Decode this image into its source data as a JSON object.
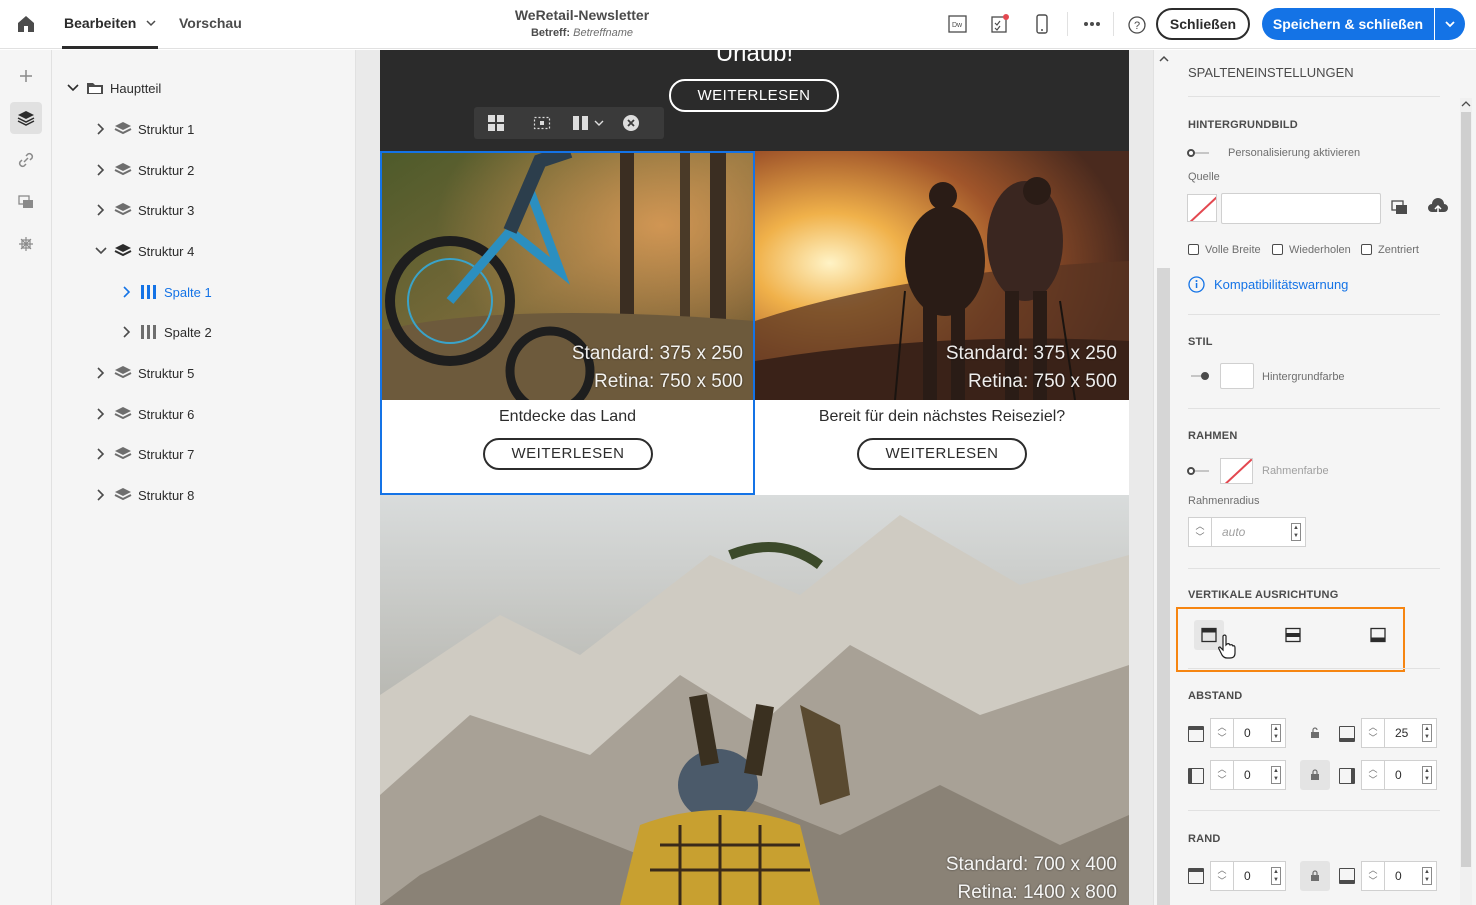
{
  "header": {
    "tabs": [
      {
        "label": "Bearbeiten"
      },
      {
        "label": "Vorschau"
      }
    ],
    "doc_title": "WeRetail-Newsletter",
    "subject_label": "Betreff:",
    "subject_value": "Betreffname",
    "close_label": "Schließen",
    "save_label": "Speichern & schließen",
    "icons": [
      "home-icon",
      "dreamweaver-icon",
      "checklist-icon",
      "mobile-icon",
      "more-icon",
      "help-icon"
    ]
  },
  "rail": {
    "items": [
      "add-icon",
      "layers-icon",
      "link-icon",
      "assets-icon",
      "fragments-icon"
    ],
    "active": "layers-icon"
  },
  "tree": {
    "root": "Hauptteil",
    "items": [
      {
        "label": "Struktur 1"
      },
      {
        "label": "Struktur 2"
      },
      {
        "label": "Struktur 3"
      },
      {
        "label": "Struktur 4"
      },
      {
        "label": "Spalte 1"
      },
      {
        "label": "Spalte 2"
      },
      {
        "label": "Struktur 5"
      },
      {
        "label": "Struktur 6"
      },
      {
        "label": "Struktur 7"
      },
      {
        "label": "Struktur 8"
      }
    ]
  },
  "email": {
    "hero_text": "Urlaub!",
    "hero_button": "WEITERLESEN",
    "col1": {
      "img_label_1": "Standard: 375 x 250",
      "img_label_2": "Retina: 750 x 500",
      "title": "Entdecke das Land",
      "button": "WEITERLESEN"
    },
    "col2": {
      "img_label_1": "Standard: 375 x 250",
      "img_label_2": "Retina: 750 x 500",
      "title": "Bereit für dein nächstes Reiseziel?",
      "button": "WEITERLESEN"
    },
    "big": {
      "img_label_1": "Standard: 700 x 400",
      "img_label_2": "Retina: 1400 x 800"
    }
  },
  "settings": {
    "title": "SPALTENEINSTELLUNGEN",
    "bg_image": {
      "section": "HINTERGRUNDBILD",
      "personalize": "Personalisierung aktivieren",
      "source_label": "Quelle",
      "source_value": "",
      "options": [
        "Volle Breite",
        "Wiederholen",
        "Zentriert"
      ],
      "compat": "Kompatibilitätswarnung"
    },
    "style": {
      "section": "STIL",
      "bg_color": "Hintergrundfarbe"
    },
    "border": {
      "section": "RAHMEN",
      "color_label": "Rahmenfarbe",
      "radius_label": "Rahmenradius",
      "radius_placeholder": "auto"
    },
    "valign": {
      "section": "VERTIKALE AUSRICHTUNG",
      "options": [
        "top",
        "middle",
        "bottom"
      ],
      "selected": "top"
    },
    "spacing": {
      "section": "ABSTAND",
      "top": "0",
      "bottom": "25",
      "left": "0",
      "right": "0"
    },
    "margin": {
      "section": "RAND",
      "top": "0",
      "bottom": "0"
    }
  },
  "colors": {
    "accent": "#1473e6",
    "highlight": "#f68511",
    "dark_band": "#2b2b2b"
  }
}
